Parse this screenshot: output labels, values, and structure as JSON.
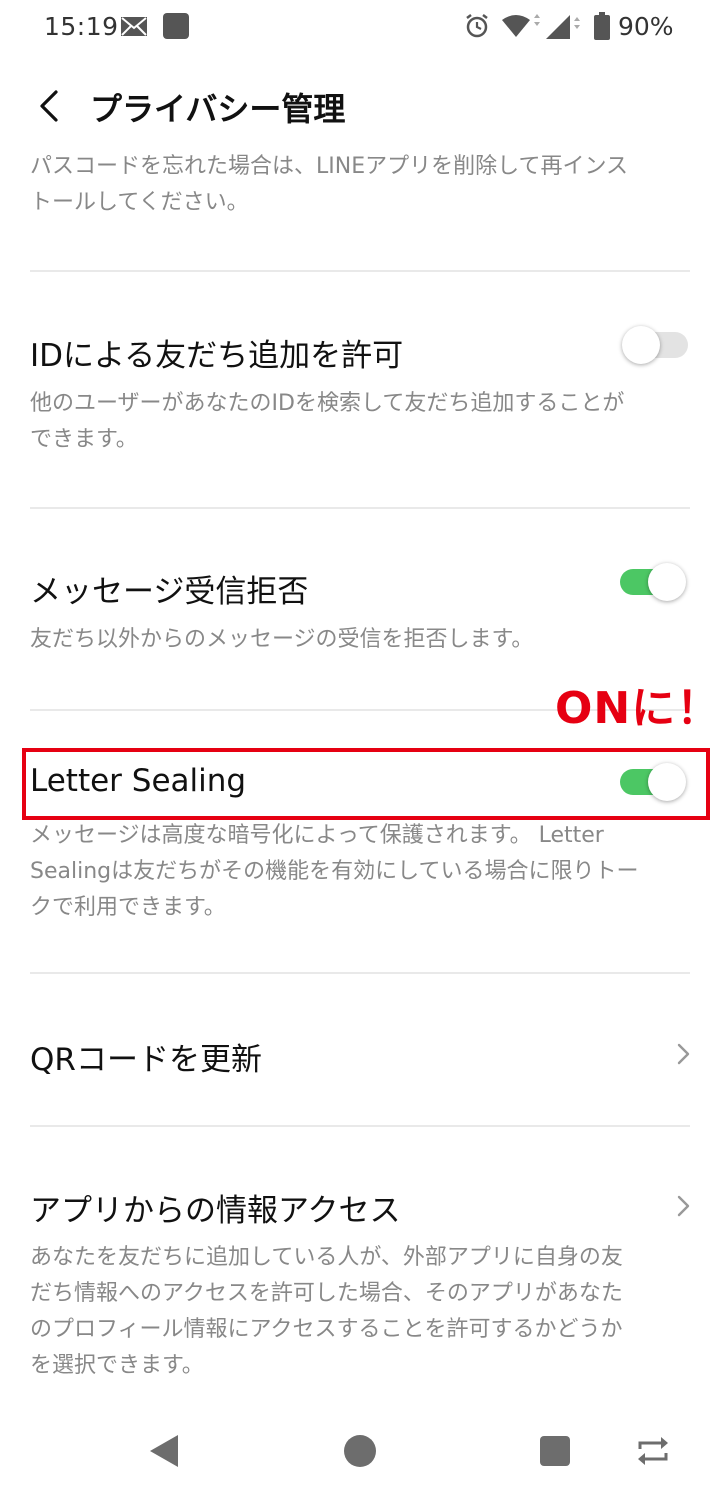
{
  "status_bar": {
    "time": "15:19",
    "battery_percent": "90%",
    "icons": [
      "mail-icon",
      "app-notification-icon",
      "alarm-icon",
      "wifi-icon",
      "signal-icon",
      "battery-icon"
    ]
  },
  "header": {
    "title": "プライバシー管理"
  },
  "intro": {
    "description_line1": "パスコードを忘れた場合は、LINEアプリを削除して再インス",
    "description_line2": "トールしてください。"
  },
  "settings": {
    "add_by_id": {
      "title": "IDによる友だち追加を許可",
      "description_line1": "他のユーザーがあなたのIDを検索して友だち追加することが",
      "description_line2": "できます。",
      "enabled": false
    },
    "block_messages": {
      "title": "メッセージ受信拒否",
      "description_line1": "友だち以外からのメッセージの受信を拒否します。",
      "enabled": true
    },
    "letter_sealing": {
      "title": "Letter Sealing",
      "description_line1": "メッセージは高度な暗号化によって保護されます。 Letter",
      "description_line2": "Sealingは友だちがその機能を有効にしている場合に限りトー",
      "description_line3": "クで利用できます。",
      "enabled": true
    },
    "update_qr": {
      "title": "QRコードを更新"
    },
    "app_access": {
      "title": "アプリからの情報アクセス",
      "description_line1": "あなたを友だちに追加している人が、外部アプリに自身の友",
      "description_line2": "だち情報へのアクセスを許可した場合、そのアプリがあなた",
      "description_line3": "のプロフィール情報にアクセスすることを許可するかどうか",
      "description_line4": "を選択できます。"
    }
  },
  "annotation": {
    "text": "ONに！",
    "color": "#e60012"
  },
  "colors": {
    "toggle_on": "#4cc764",
    "toggle_off": "#e3e3e3",
    "description_text": "#888888"
  },
  "nav_bar": {
    "icons": [
      "back-triangle-icon",
      "home-circle-icon",
      "recent-square-icon",
      "rotate-icon"
    ]
  }
}
